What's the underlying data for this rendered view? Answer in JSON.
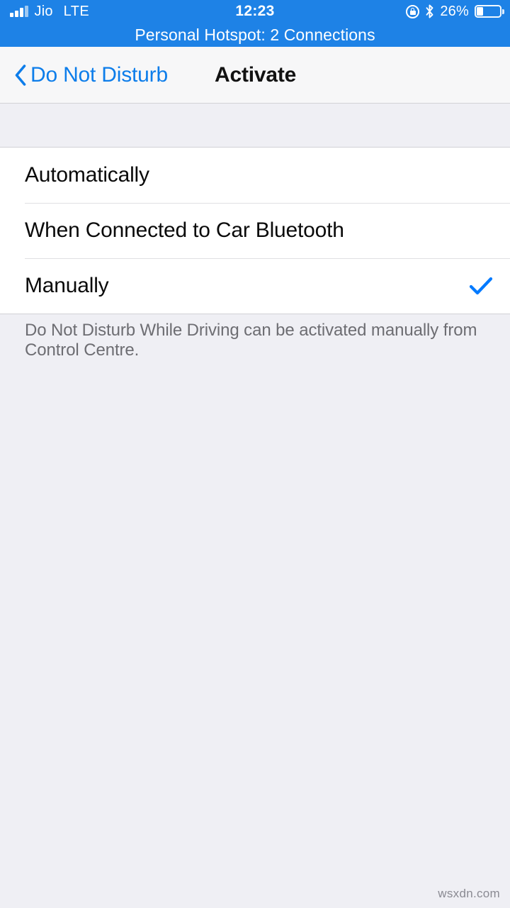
{
  "status_bar": {
    "carrier": "Jio",
    "network": "LTE",
    "time": "12:23",
    "battery_percent": "26%",
    "signal_icon": "signal-bars-icon",
    "rotation_lock_icon": "rotation-lock-icon",
    "bluetooth_icon": "bluetooth-icon",
    "battery_icon": "battery-icon",
    "hotspot_banner": "Personal Hotspot: 2 Connections",
    "background_color": "#1E82E6"
  },
  "nav_bar": {
    "back_label": "Do Not Disturb",
    "back_icon": "chevron-left-icon",
    "title": "Activate",
    "tint_color": "#0D7DEA"
  },
  "options": {
    "items": [
      {
        "label": "Automatically",
        "selected": false
      },
      {
        "label": "When Connected to Car Bluetooth",
        "selected": false
      },
      {
        "label": "Manually",
        "selected": true
      }
    ],
    "checkmark_icon": "checkmark-icon",
    "checkmark_color": "#007AFF"
  },
  "footer": {
    "note": "Do Not Disturb While Driving can be activated manually from Control Centre."
  },
  "watermark": {
    "text": "wsxdn.com"
  }
}
